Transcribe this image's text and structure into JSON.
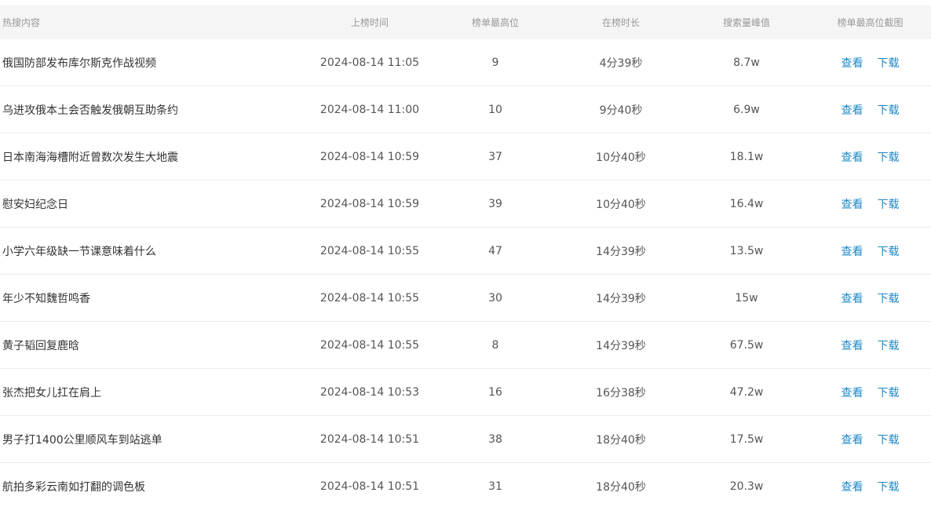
{
  "table": {
    "headers": {
      "title": "热搜内容",
      "time": "上榜时间",
      "rank": "榜单最高位",
      "duration": "在榜时长",
      "peak": "搜索量峰值",
      "screenshot": "榜单最高位截图"
    },
    "view_label": "查看",
    "download_label": "下载",
    "rows": [
      {
        "title": "俄国防部发布库尔斯克作战视频",
        "time": "2024-08-14 11:05",
        "rank": "9",
        "duration": "4分39秒",
        "peak": "8.7w"
      },
      {
        "title": "乌进攻俄本土会否触发俄朝互助条约",
        "time": "2024-08-14 11:00",
        "rank": "10",
        "duration": "9分40秒",
        "peak": "6.9w"
      },
      {
        "title": "日本南海海槽附近曾数次发生大地震",
        "time": "2024-08-14 10:59",
        "rank": "37",
        "duration": "10分40秒",
        "peak": "18.1w"
      },
      {
        "title": "慰安妇纪念日",
        "time": "2024-08-14 10:59",
        "rank": "39",
        "duration": "10分40秒",
        "peak": "16.4w"
      },
      {
        "title": "小学六年级缺一节课意味着什么",
        "time": "2024-08-14 10:55",
        "rank": "47",
        "duration": "14分39秒",
        "peak": "13.5w"
      },
      {
        "title": "年少不知魏哲鸣香",
        "time": "2024-08-14 10:55",
        "rank": "30",
        "duration": "14分39秒",
        "peak": "15w"
      },
      {
        "title": "黄子韬回复鹿晗",
        "time": "2024-08-14 10:55",
        "rank": "8",
        "duration": "14分39秒",
        "peak": "67.5w"
      },
      {
        "title": "张杰把女儿扛在肩上",
        "time": "2024-08-14 10:53",
        "rank": "16",
        "duration": "16分38秒",
        "peak": "47.2w"
      },
      {
        "title": "男子打1400公里顺风车到站逃单",
        "time": "2024-08-14 10:51",
        "rank": "38",
        "duration": "18分40秒",
        "peak": "17.5w"
      },
      {
        "title": "航拍多彩云南如打翻的调色板",
        "time": "2024-08-14 10:51",
        "rank": "31",
        "duration": "18分40秒",
        "peak": "20.3w"
      }
    ]
  }
}
